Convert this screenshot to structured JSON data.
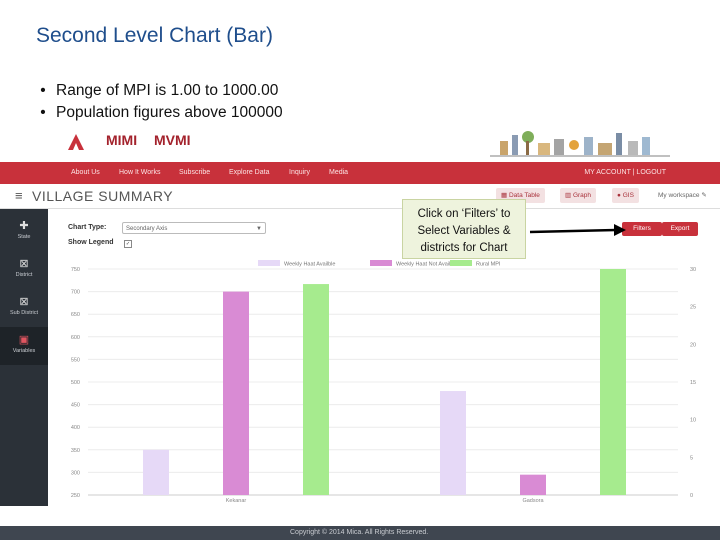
{
  "slide": {
    "title": "Second Level Chart (Bar)",
    "bullets": [
      "Range of MPI is 1.00 to 1000.00",
      "Population figures above 100000"
    ]
  },
  "logos": {
    "mica": "MICA",
    "mimi": "MIMI",
    "mvmi": "MVMI"
  },
  "navbar": {
    "items": [
      "About Us",
      "How It Works",
      "Subscribe",
      "Explore Data",
      "Inquiry",
      "Media"
    ],
    "account": "MY ACCOUNT | LOGOUT",
    "color": "#c8313b"
  },
  "subheader": {
    "title": "VILLAGE SUMMARY",
    "buttons": [
      "Data Table",
      "Graph",
      "GIS"
    ],
    "workspace": "My workspace"
  },
  "sidebar": {
    "items": [
      {
        "label": "State",
        "icon": "cross-icon"
      },
      {
        "label": "District",
        "icon": "map-icon"
      },
      {
        "label": "Sub District",
        "icon": "map-icon"
      },
      {
        "label": "Variables",
        "icon": "variables-icon"
      }
    ],
    "active_index": 3
  },
  "controls": {
    "chart_type_label": "Chart Type:",
    "chart_type_value": "Secondary Axis",
    "show_legend_label": "Show Legend",
    "show_legend_checked": true,
    "filters_label": "Filters",
    "export_label": "Export"
  },
  "callout": {
    "lines": [
      "Click on ‘Filters’ to",
      "Select Variables &",
      "districts for Chart"
    ]
  },
  "chart_data": {
    "type": "bar",
    "categories": [
      "Kekanar",
      "Gadsora"
    ],
    "series": [
      {
        "name": "Weekly Haat Availble",
        "values": [
          350,
          480
        ],
        "color": "#e6d9f7",
        "axis": "left"
      },
      {
        "name": "Weekly Haat Not Availabe",
        "values": [
          700,
          295
        ],
        "color": "#d98bd4",
        "axis": "left"
      },
      {
        "name": "Rural MPI",
        "values": [
          28,
          30
        ],
        "color": "#a6eb8e",
        "axis": "right"
      }
    ],
    "y_left": {
      "min": 250,
      "max": 750,
      "ticks": [
        750,
        700,
        650,
        600,
        550,
        500,
        450,
        400,
        350,
        300,
        250
      ]
    },
    "y_right": {
      "min": 0,
      "max": 30,
      "ticks": [
        30,
        25,
        20,
        15,
        10,
        5,
        0
      ]
    },
    "legend_position": "top-center",
    "grid": true
  },
  "footer": {
    "text": "Copyright © 2014 Mica. All Rights Reserved."
  }
}
